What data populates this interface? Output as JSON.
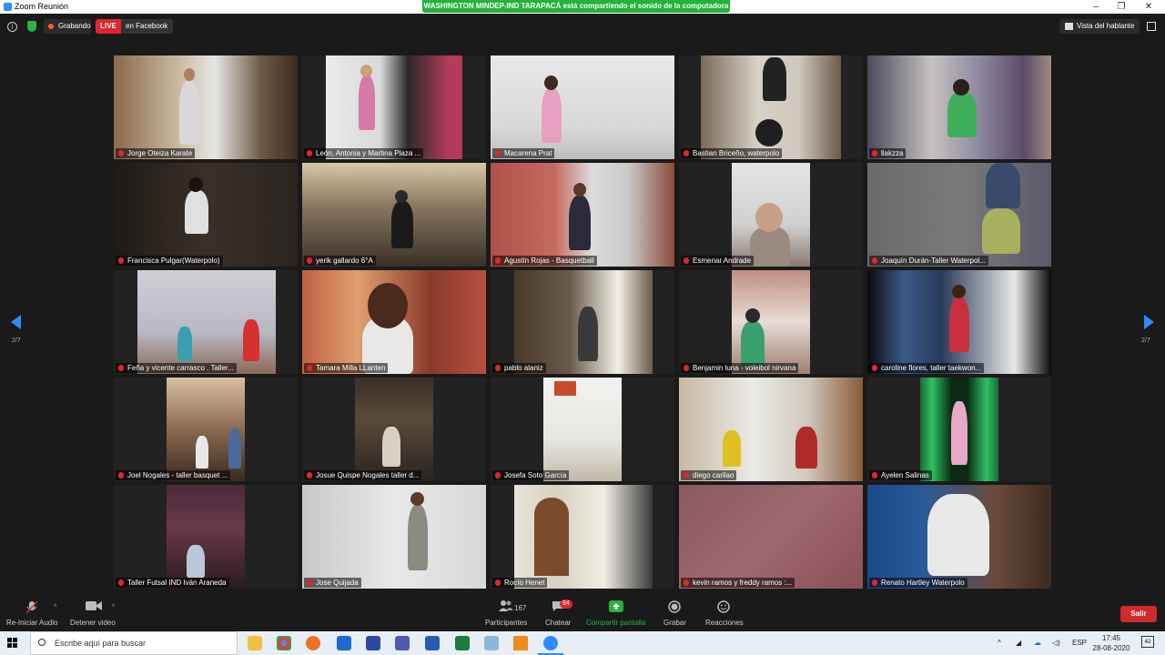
{
  "window": {
    "title": "Zoom Reunión",
    "share_banner": "WASHINGTON MINDEP-IND TARAPACÁ está compartiendo el sonido de la computadora",
    "minimize": "–",
    "maximize": "❐",
    "close": "✕"
  },
  "topbar": {
    "recording_label": "Grabando",
    "live_badge": "LIVE",
    "live_label": "en Facebook",
    "speaker_view_label": "Vista del hablante",
    "info_glyph": "i"
  },
  "navigation": {
    "page_left": "2/7",
    "page_right": "2/7"
  },
  "participants": [
    {
      "name": "Jorge Oteiza Karate"
    },
    {
      "name": "León, Antonia y Martina Plaza ..."
    },
    {
      "name": "Macarena Prat"
    },
    {
      "name": "Bastian Briceño, waterpolo"
    },
    {
      "name": "llakzza"
    },
    {
      "name": "Francisca Pulgar(Waterpolo)"
    },
    {
      "name": "yerik gallardo 6°A"
    },
    {
      "name": "Agustín Rojas - Basquetball"
    },
    {
      "name": "Esmenar Andrade"
    },
    {
      "name": "Joaquín Durán-Taller Waterpol..."
    },
    {
      "name": "Feña y vicente carrasco . Taller..."
    },
    {
      "name": "Tamara Milla LLanten"
    },
    {
      "name": "pablo alaniz"
    },
    {
      "name": "Benjamin luna - voleibol nirvana"
    },
    {
      "name": "caroline flores, taller taekwon..."
    },
    {
      "name": "Joel Nogales - taller basquet ..."
    },
    {
      "name": "Josue Quispe Nogales taller d..."
    },
    {
      "name": "Josefa Soto García"
    },
    {
      "name": "diego carilao"
    },
    {
      "name": "Ayelen Salinas"
    },
    {
      "name": "Taller Futsal IND Iván Araneda"
    },
    {
      "name": "Jose Quijada"
    },
    {
      "name": "Rocío Henet"
    },
    {
      "name": "kevin ramos y freddy ramos :..."
    },
    {
      "name": "Renato Hartley Waterpolo"
    }
  ],
  "toolbar": {
    "audio_label": "Re-Iniciar Audio",
    "video_label": "Detener video",
    "participants_label": "Participantes",
    "participants_count": "167",
    "chat_label": "Chatear",
    "chat_badge": "94",
    "share_label": "Compartir pantalla",
    "record_label": "Grabar",
    "reactions_label": "Reacciones",
    "leave_label": "Salir"
  },
  "taskbar": {
    "search_placeholder": "Escribe aquí para buscar",
    "language": "ESP",
    "time": "17:45",
    "date": "28-08-2020",
    "notifications": "42"
  },
  "colors": {
    "accent": "#2d8cff",
    "live": "#e0262c",
    "share": "#23b33a"
  }
}
